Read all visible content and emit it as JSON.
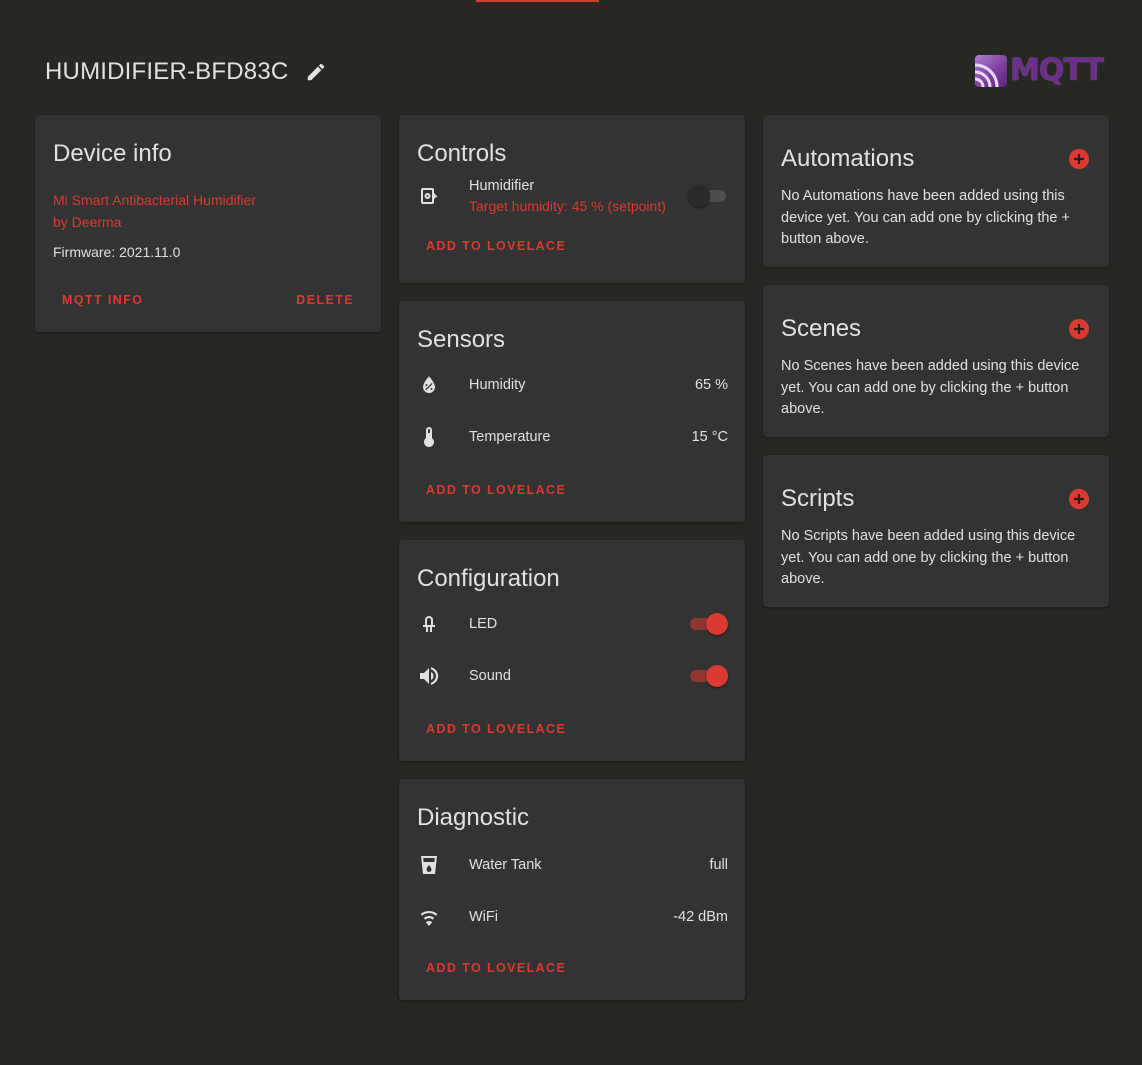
{
  "header": {
    "title": "HUMIDIFIER-BFD83C",
    "edit_icon": "pencil-icon",
    "logo_text": "MQTT"
  },
  "device_info": {
    "title": "Device info",
    "model": "Mi Smart Antibacterial Humidifier",
    "manufacturer": "by Deerma",
    "firmware": "Firmware: 2021.11.0",
    "mqtt_info_label": "MQTT INFO",
    "delete_label": "DELETE"
  },
  "controls": {
    "title": "Controls",
    "entities": [
      {
        "icon": "air-humidifier-icon",
        "name": "Humidifier",
        "state": "Target humidity: 45 % (setpoint)",
        "on": false
      }
    ],
    "add_label": "ADD TO LOVELACE"
  },
  "sensors": {
    "title": "Sensors",
    "entities": [
      {
        "icon": "water-percent-icon",
        "name": "Humidity",
        "value": "65 %"
      },
      {
        "icon": "thermometer-icon",
        "name": "Temperature",
        "value": "15 °C"
      }
    ],
    "add_label": "ADD TO LOVELACE"
  },
  "configuration": {
    "title": "Configuration",
    "entities": [
      {
        "icon": "led-icon",
        "name": "LED",
        "on": true
      },
      {
        "icon": "volume-icon",
        "name": "Sound",
        "on": true
      }
    ],
    "add_label": "ADD TO LOVELACE"
  },
  "diagnostic": {
    "title": "Diagnostic",
    "entities": [
      {
        "icon": "water-tank-icon",
        "name": "Water Tank",
        "value": "full"
      },
      {
        "icon": "wifi-icon",
        "name": "WiFi",
        "value": "-42 dBm"
      }
    ],
    "add_label": "ADD TO LOVELACE"
  },
  "automations": {
    "title": "Automations",
    "text": "No Automations have been added using this device yet. You can add one by clicking the + button above."
  },
  "scenes": {
    "title": "Scenes",
    "text": "No Scenes have been added using this device yet. You can add one by clicking the + button above."
  },
  "scripts": {
    "title": "Scripts",
    "text": "No Scripts have been added using this device yet. You can add one by clicking the + button above."
  },
  "colors": {
    "accent": "#db3a32",
    "background": "#272823",
    "card": "#333333",
    "text": "#e1e1e1"
  }
}
